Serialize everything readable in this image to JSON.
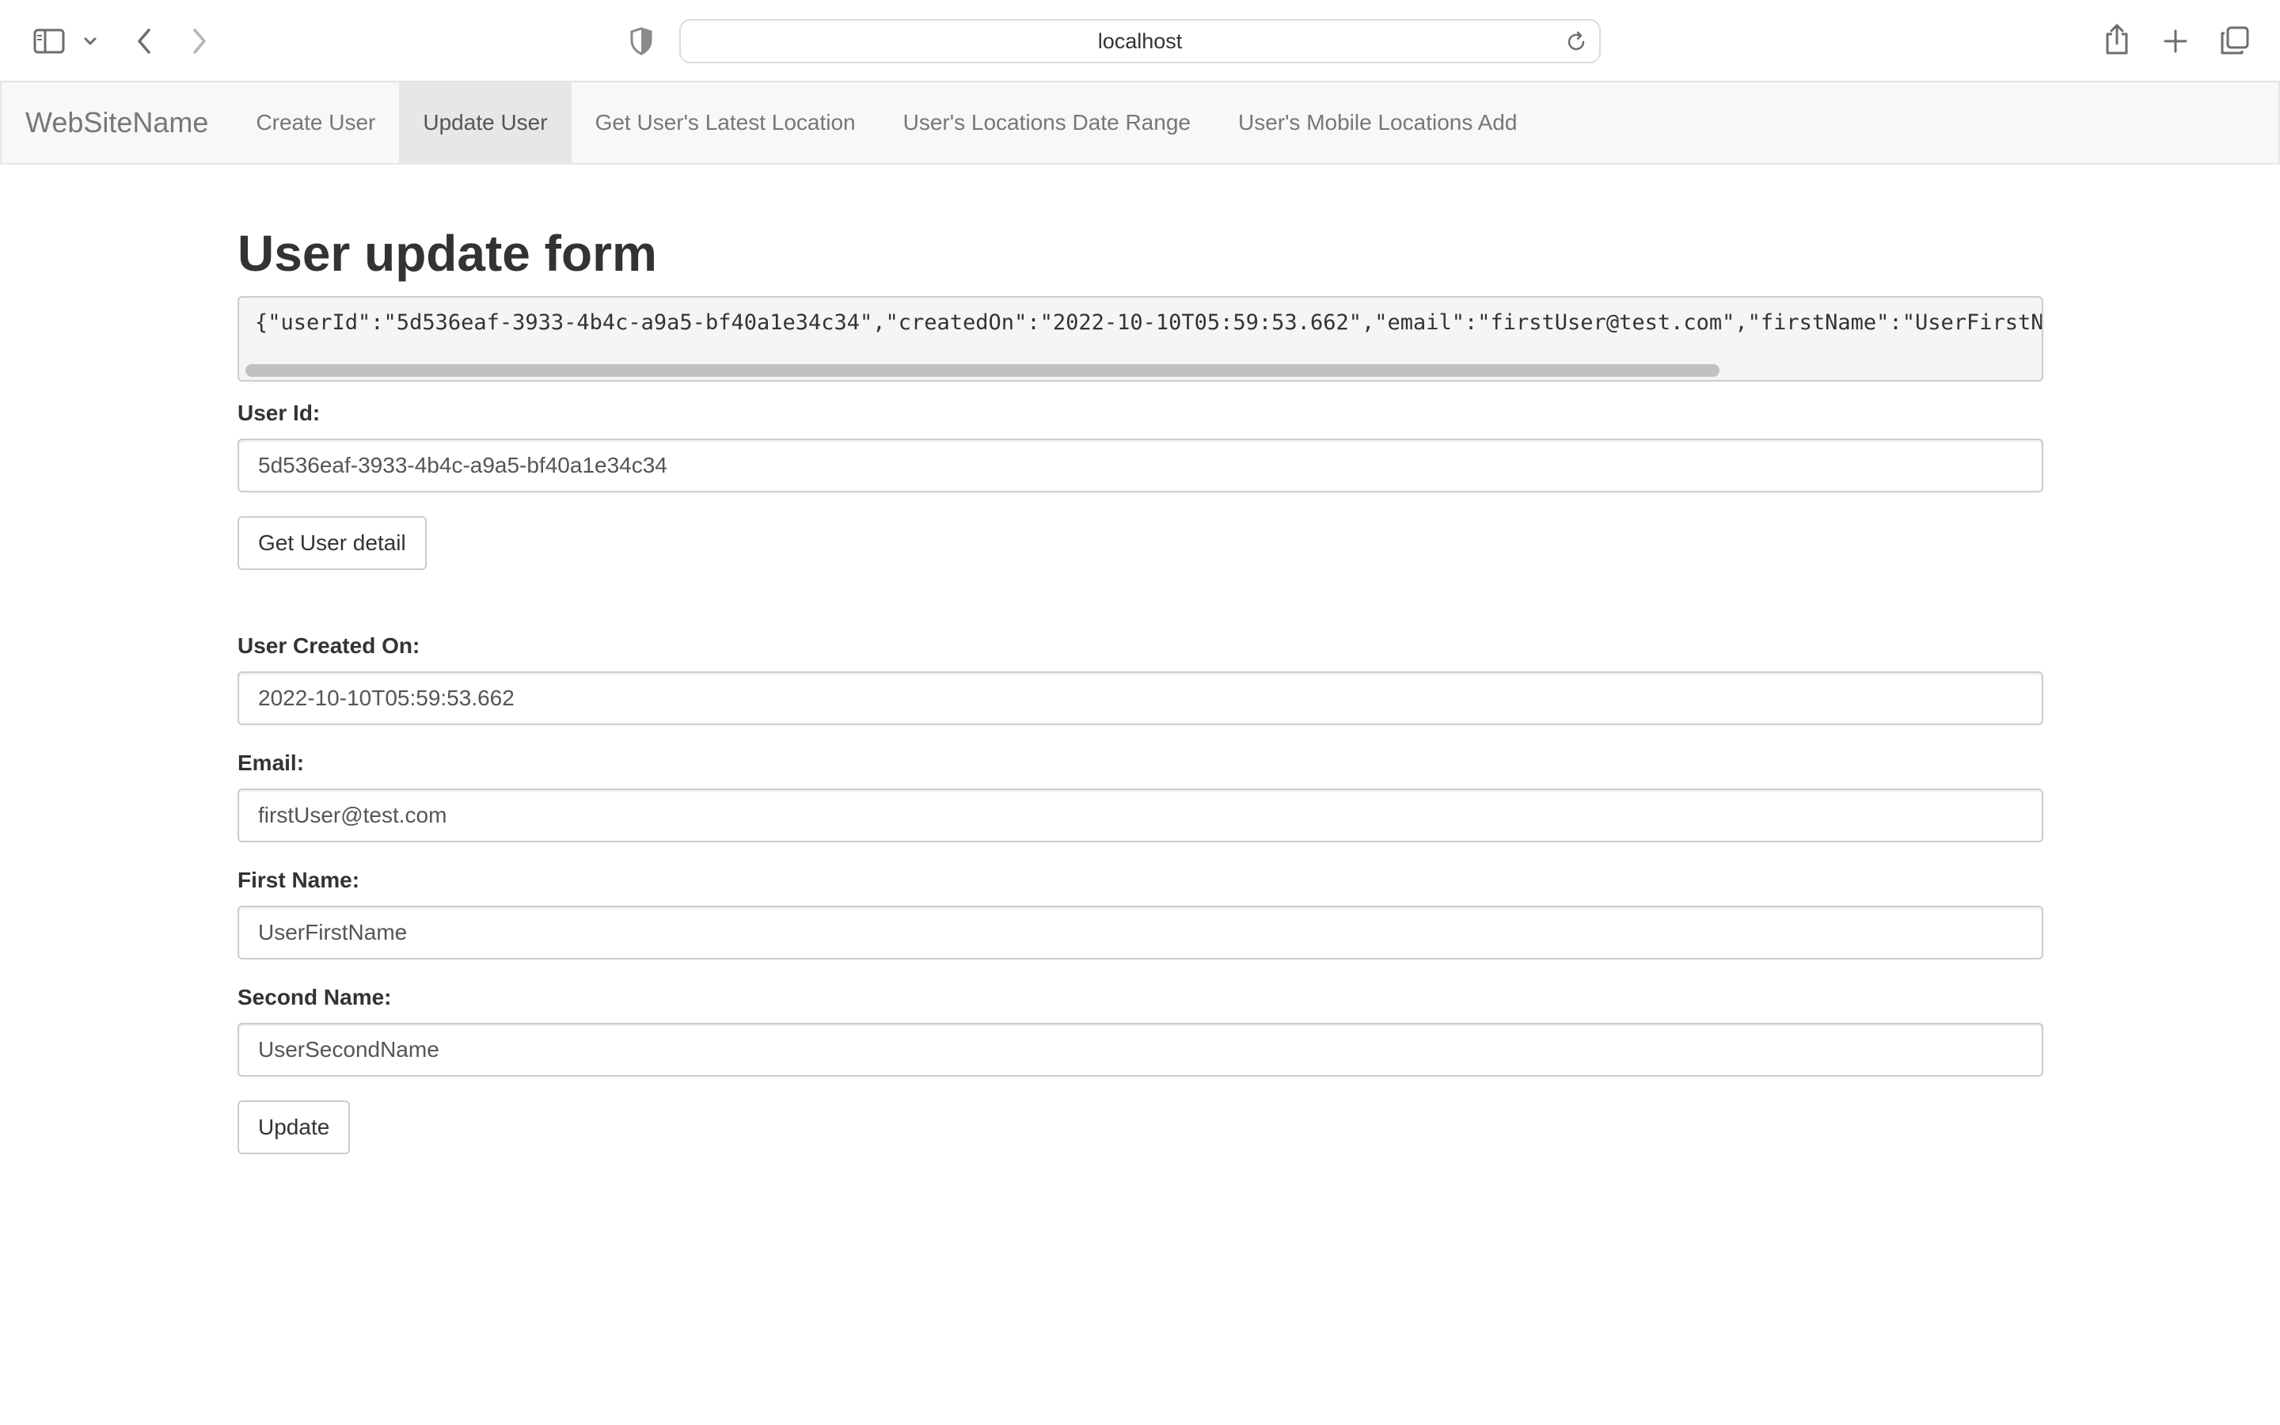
{
  "browser": {
    "url": "localhost",
    "icons": {
      "sidebar": "sidebar-icon",
      "sidebar_menu": "chevron-down-icon",
      "back": "chevron-left-icon",
      "forward": "chevron-right-icon",
      "privacy": "shield-icon",
      "reload": "reload-icon",
      "share": "share-icon",
      "new_tab": "plus-icon",
      "tabs": "tabs-overview-icon"
    }
  },
  "navbar": {
    "brand": "WebSiteName",
    "items": [
      {
        "label": "Create User",
        "active": false
      },
      {
        "label": "Update User",
        "active": true
      },
      {
        "label": "Get User's Latest Location",
        "active": false
      },
      {
        "label": "User's Locations Date Range",
        "active": false
      },
      {
        "label": "User's Mobile Locations Add",
        "active": false
      }
    ]
  },
  "form": {
    "title": "User update form",
    "json_output": "{\"userId\":\"5d536eaf-3933-4b4c-a9a5-bf40a1e34c34\",\"createdOn\":\"2022-10-10T05:59:53.662\",\"email\":\"firstUser@test.com\",\"firstName\":\"UserFirstName\",\"",
    "user_id": {
      "label": "User Id:",
      "value": "5d536eaf-3933-4b4c-a9a5-bf40a1e34c34"
    },
    "get_detail_button": "Get User detail",
    "created_on": {
      "label": "User Created On:",
      "value": "2022-10-10T05:59:53.662"
    },
    "email": {
      "label": "Email:",
      "value": "firstUser@test.com"
    },
    "first_name": {
      "label": "First Name:",
      "value": "UserFirstName"
    },
    "second_name": {
      "label": "Second Name:",
      "value": "UserSecondName"
    },
    "update_button": "Update"
  },
  "colors": {
    "navbar_bg": "#f8f8f8",
    "nav_active_bg": "#e7e7e7",
    "nav_text": "#777777",
    "text": "#333333"
  }
}
